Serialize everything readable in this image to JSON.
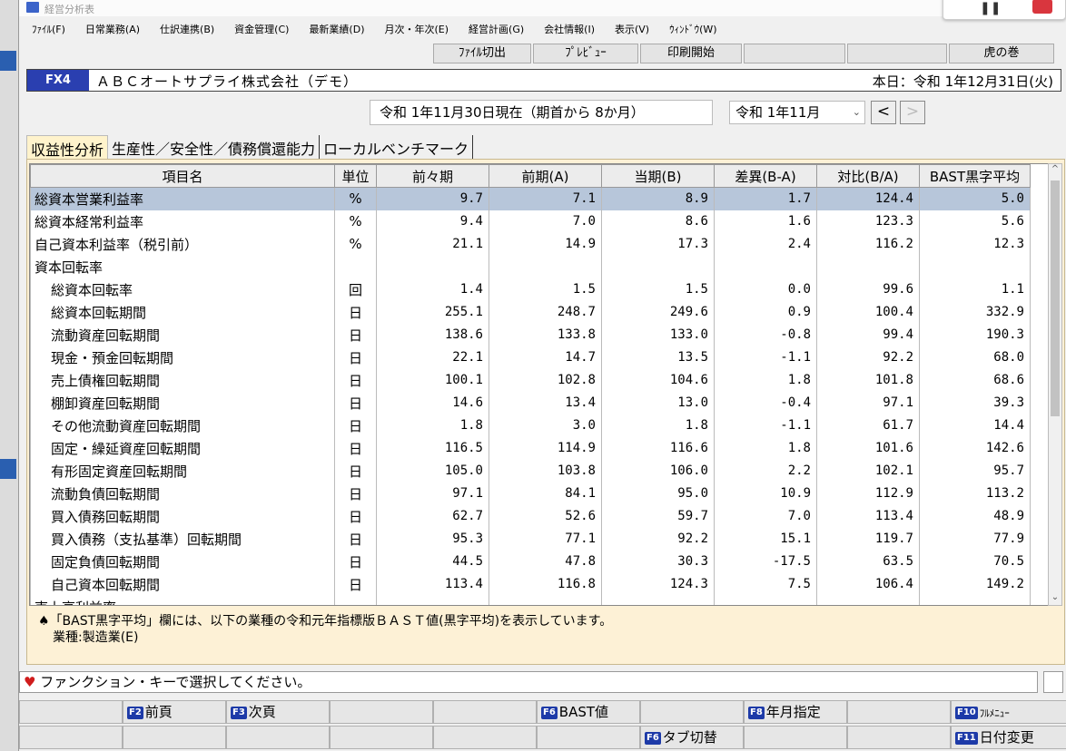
{
  "window": {
    "title": "経営分析表"
  },
  "menu": [
    "ﾌｧｲﾙ(F)",
    "日常業務(A)",
    "仕訳連携(B)",
    "資金管理(C)",
    "最新業績(D)",
    "月次・年次(E)",
    "経営計画(G)",
    "会社情報(I)",
    "表示(V)",
    "ｳｨﾝﾄﾞｳ(W)"
  ],
  "toolbar": {
    "export": "ﾌｧｲﾙ切出",
    "preview": "ﾌﾟﾚﾋﾞｭｰ",
    "print": "印刷開始",
    "tora": "虎の巻"
  },
  "header": {
    "code": "FX4",
    "company": "ＡＢＣオートサプライ株式会社（デモ）",
    "today": "本日：令和 1年12月31日(火)"
  },
  "period": {
    "label": "令和 1年11月30日現在（期首から 8か月）",
    "select": "令和 1年11月",
    "prev": "<",
    "next": ">"
  },
  "tabs": [
    "収益性分析",
    "生産性／安全性／債務償還能力",
    "ローカルベンチマーク"
  ],
  "table": {
    "headers": [
      "項目名",
      "単位",
      "前々期",
      "前期(A)",
      "当期(B)",
      "差異(B-A)",
      "対比(B/A)",
      "BAST黒字平均"
    ],
    "rows": [
      [
        "総資本営業利益率",
        "%",
        "9.7",
        "7.1",
        "8.9",
        "1.7",
        "124.4",
        "5.0"
      ],
      [
        "総資本経常利益率",
        "%",
        "9.4",
        "7.0",
        "8.6",
        "1.6",
        "123.3",
        "5.6"
      ],
      [
        "自己資本利益率（税引前）",
        "%",
        "21.1",
        "14.9",
        "17.3",
        "2.4",
        "116.2",
        "12.3"
      ],
      [
        "資本回転率",
        "",
        "",
        "",
        "",
        "",
        "",
        ""
      ],
      [
        "総資本回転率",
        "回",
        "1.4",
        "1.5",
        "1.5",
        "0.0",
        "99.6",
        "1.1"
      ],
      [
        "総資本回転期間",
        "日",
        "255.1",
        "248.7",
        "249.6",
        "0.9",
        "100.4",
        "332.9"
      ],
      [
        "流動資産回転期間",
        "日",
        "138.6",
        "133.8",
        "133.0",
        "-0.8",
        "99.4",
        "190.3"
      ],
      [
        "現金・預金回転期間",
        "日",
        "22.1",
        "14.7",
        "13.5",
        "-1.1",
        "92.2",
        "68.0"
      ],
      [
        "売上債権回転期間",
        "日",
        "100.1",
        "102.8",
        "104.6",
        "1.8",
        "101.8",
        "68.6"
      ],
      [
        "棚卸資産回転期間",
        "日",
        "14.6",
        "13.4",
        "13.0",
        "-0.4",
        "97.1",
        "39.3"
      ],
      [
        "その他流動資産回転期間",
        "日",
        "1.8",
        "3.0",
        "1.8",
        "-1.1",
        "61.7",
        "14.4"
      ],
      [
        "固定・繰延資産回転期間",
        "日",
        "116.5",
        "114.9",
        "116.6",
        "1.8",
        "101.6",
        "142.6"
      ],
      [
        "有形固定資産回転期間",
        "日",
        "105.0",
        "103.8",
        "106.0",
        "2.2",
        "102.1",
        "95.7"
      ],
      [
        "流動負債回転期間",
        "日",
        "97.1",
        "84.1",
        "95.0",
        "10.9",
        "112.9",
        "113.2"
      ],
      [
        "買入債務回転期間",
        "日",
        "62.7",
        "52.6",
        "59.7",
        "7.0",
        "113.4",
        "48.9"
      ],
      [
        "買入債務（支払基準）回転期間",
        "日",
        "95.3",
        "77.1",
        "92.2",
        "15.1",
        "119.7",
        "77.9"
      ],
      [
        "固定負債回転期間",
        "日",
        "44.5",
        "47.8",
        "30.3",
        "-17.5",
        "63.5",
        "70.5"
      ],
      [
        "自己資本回転期間",
        "日",
        "113.4",
        "116.8",
        "124.3",
        "7.5",
        "106.4",
        "149.2"
      ],
      [
        "売上高利益率",
        "",
        "",
        "",
        "",
        "",
        "",
        ""
      ]
    ]
  },
  "note": {
    "line1": "♠「BAST黒字平均」欄には、以下の業種の令和元年指標版ＢＡＳＴ値(黒字平均)を表示しています。",
    "line2": "業種:製造業(E)"
  },
  "prompt": "ファンクション・キーで選択してください。",
  "fkeys1": {
    "f2": "前頁",
    "f3": "次頁",
    "f6": "BAST値",
    "f8": "年月指定",
    "f10": "ﾌﾙﾒﾆｭｰ"
  },
  "fkeys2": {
    "f6": "タブ切替",
    "f11": "日付変更"
  },
  "keys": {
    "f2": "F2",
    "f3": "F3",
    "f6": "F6",
    "f8": "F8",
    "f10": "F10",
    "f11": "F11"
  },
  "colors": {
    "header_blue": "#2a3fb0",
    "panel_bg": "#fdf1d6",
    "selected_row": "#b7c6da",
    "heart": "#d01c1c"
  }
}
